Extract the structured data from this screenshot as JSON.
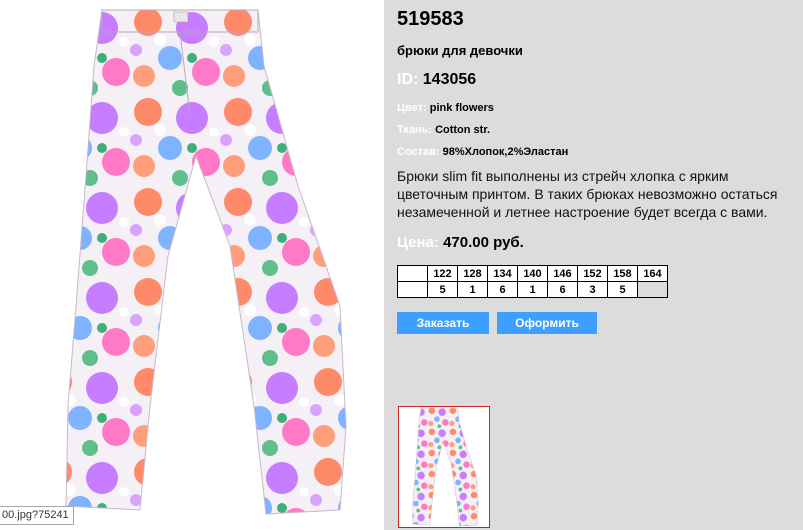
{
  "product": {
    "article": "519583",
    "subtitle": "брюки для девочки",
    "id_label": "ID:",
    "id_value": "143056",
    "color_label": "Цвет:",
    "color_value": "pink flowers",
    "fabric_label": "Ткань:",
    "fabric_value": "Cotton str.",
    "composition_label": "Состав:",
    "composition_value": "98%Хлопок,2%Эластан",
    "description": "Брюки slim fit выполнены из стрейч хлопка с ярким цветочным принтом. В таких брюках невозможно остаться незамеченной и летнее настроение будет всегда с вами.",
    "price_label": "Цена:",
    "price_value": "470.00 руб."
  },
  "sizes": {
    "headers": [
      "122",
      "128",
      "134",
      "140",
      "146",
      "152",
      "158",
      "164"
    ],
    "quantities": [
      "5",
      "1",
      "6",
      "1",
      "6",
      "3",
      "5",
      ""
    ]
  },
  "buttons": {
    "order": "Заказать",
    "checkout": "Оформить"
  },
  "status_tip": "00.jpg?75241",
  "colors": {
    "panel_bg": "#dcdcdc",
    "label_color": "#ffffff",
    "button_bg": "#3d9fff",
    "thumb_border": "#cc2222"
  }
}
